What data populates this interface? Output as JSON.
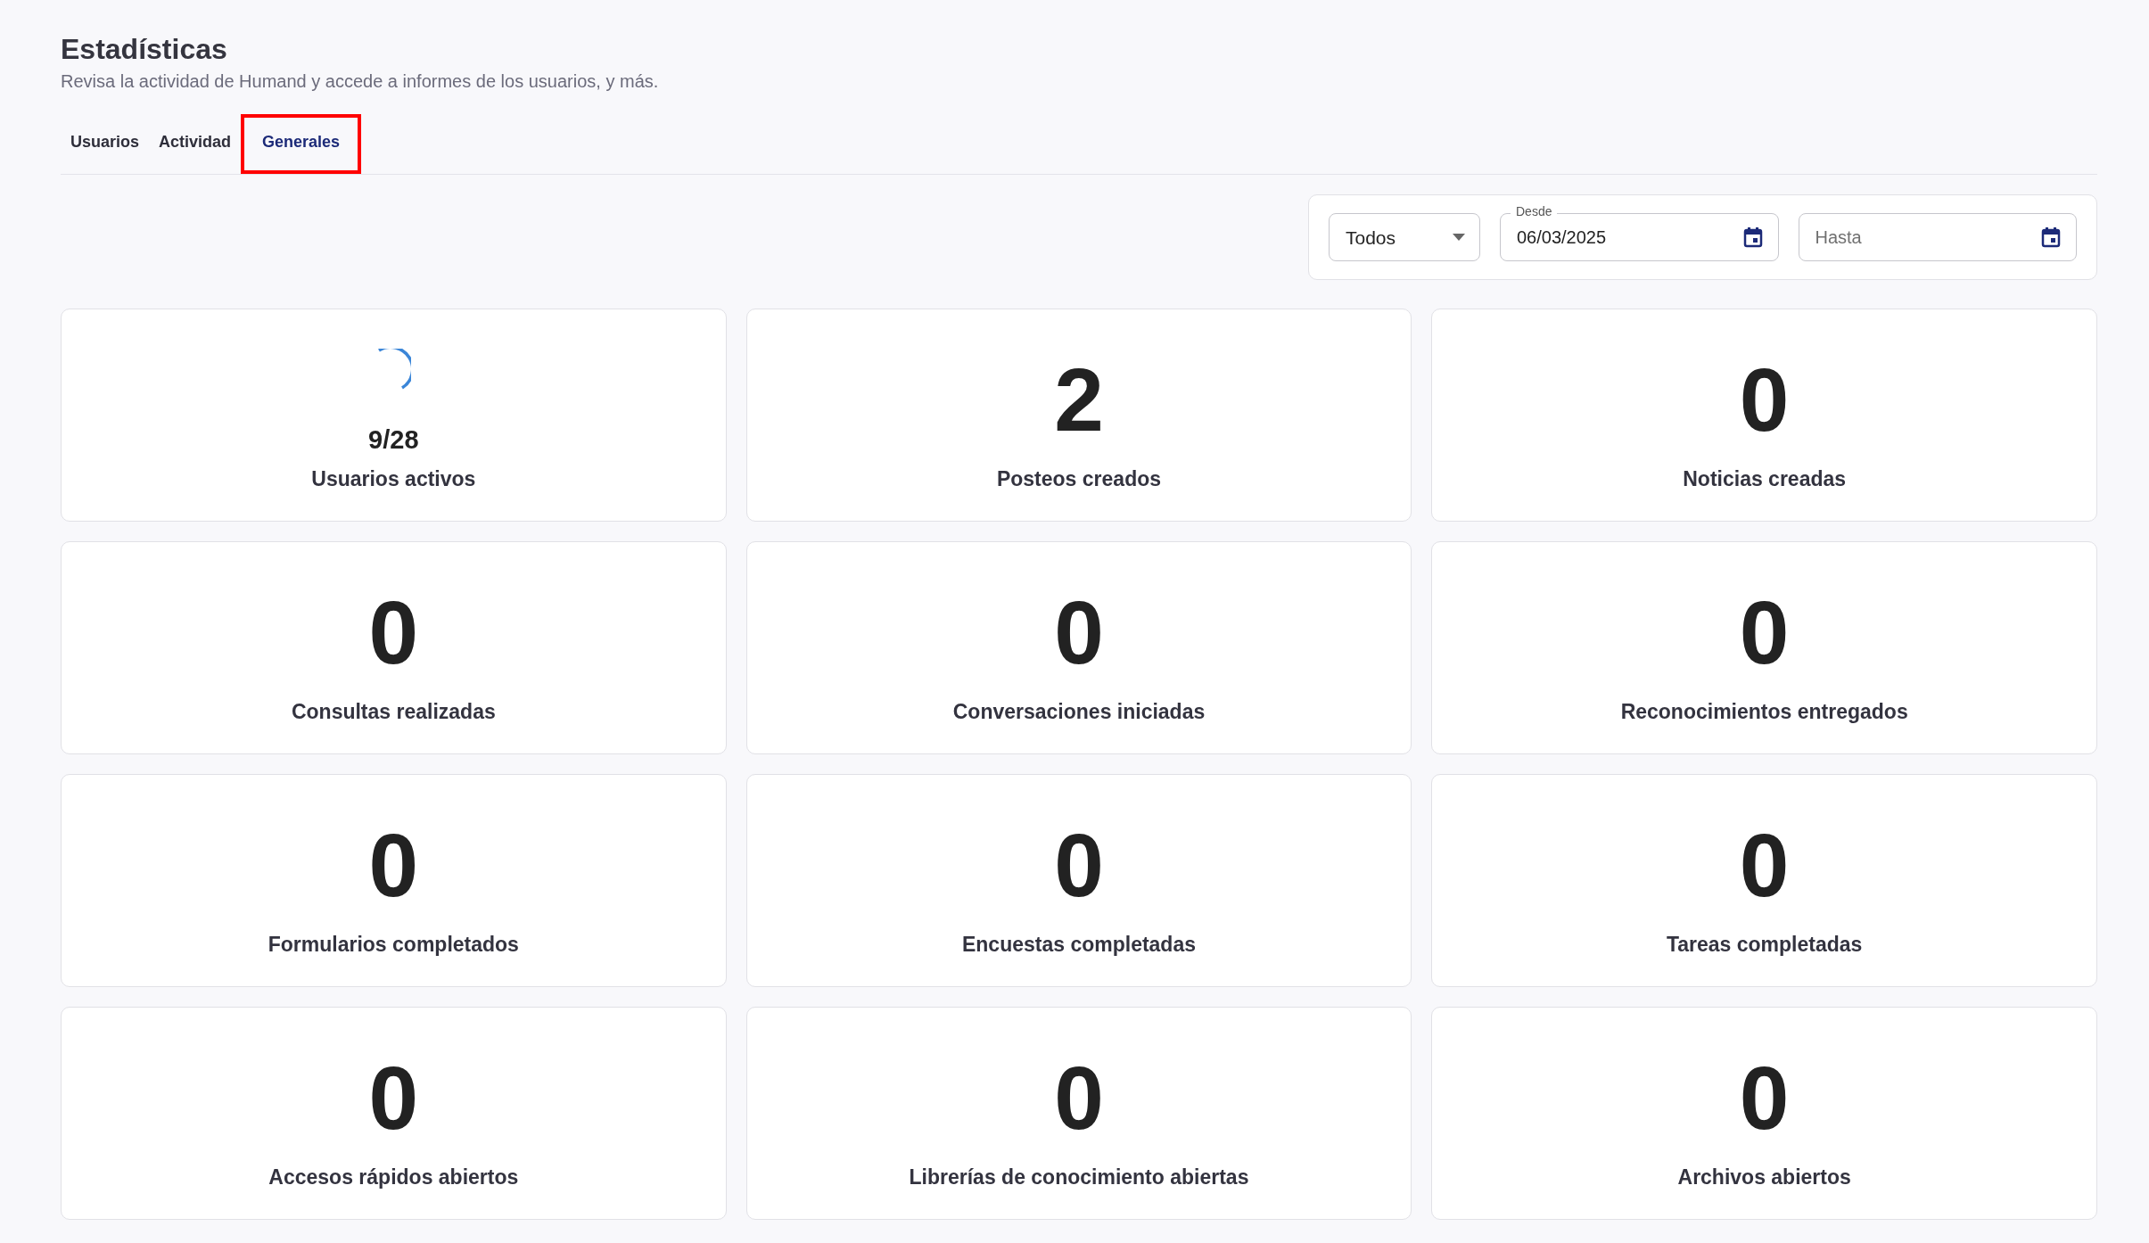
{
  "header": {
    "title": "Estadísticas",
    "subtitle": "Revisa la actividad de Humand y accede a informes de los usuarios, y más."
  },
  "tabs": [
    {
      "label": "Usuarios",
      "selected": false,
      "highlighted": false
    },
    {
      "label": "Actividad",
      "selected": false,
      "highlighted": false
    },
    {
      "label": "Generales",
      "selected": true,
      "highlighted": true
    }
  ],
  "filters": {
    "scope": {
      "value": "Todos"
    },
    "from": {
      "label": "Desde",
      "value": "06/03/2025"
    },
    "to": {
      "placeholder": "Hasta"
    }
  },
  "active_users": {
    "value": "9/28",
    "label": "Usuarios activos"
  },
  "cards": [
    {
      "kind": "number",
      "value": "2",
      "label": "Posteos creados"
    },
    {
      "kind": "number",
      "value": "0",
      "label": "Noticias creadas"
    },
    {
      "kind": "number",
      "value": "0",
      "label": "Consultas realizadas"
    },
    {
      "kind": "number",
      "value": "0",
      "label": "Conversaciones iniciadas"
    },
    {
      "kind": "number",
      "value": "0",
      "label": "Reconocimientos entregados"
    },
    {
      "kind": "number",
      "value": "0",
      "label": "Formularios completados"
    },
    {
      "kind": "number",
      "value": "0",
      "label": "Encuestas completadas"
    },
    {
      "kind": "number",
      "value": "0",
      "label": "Tareas completadas"
    },
    {
      "kind": "number",
      "value": "0",
      "label": "Accesos rápidos abiertos"
    },
    {
      "kind": "number",
      "value": "0",
      "label": "Librerías de conocimiento abiertas"
    },
    {
      "kind": "number",
      "value": "0",
      "label": "Archivos abiertos"
    }
  ]
}
